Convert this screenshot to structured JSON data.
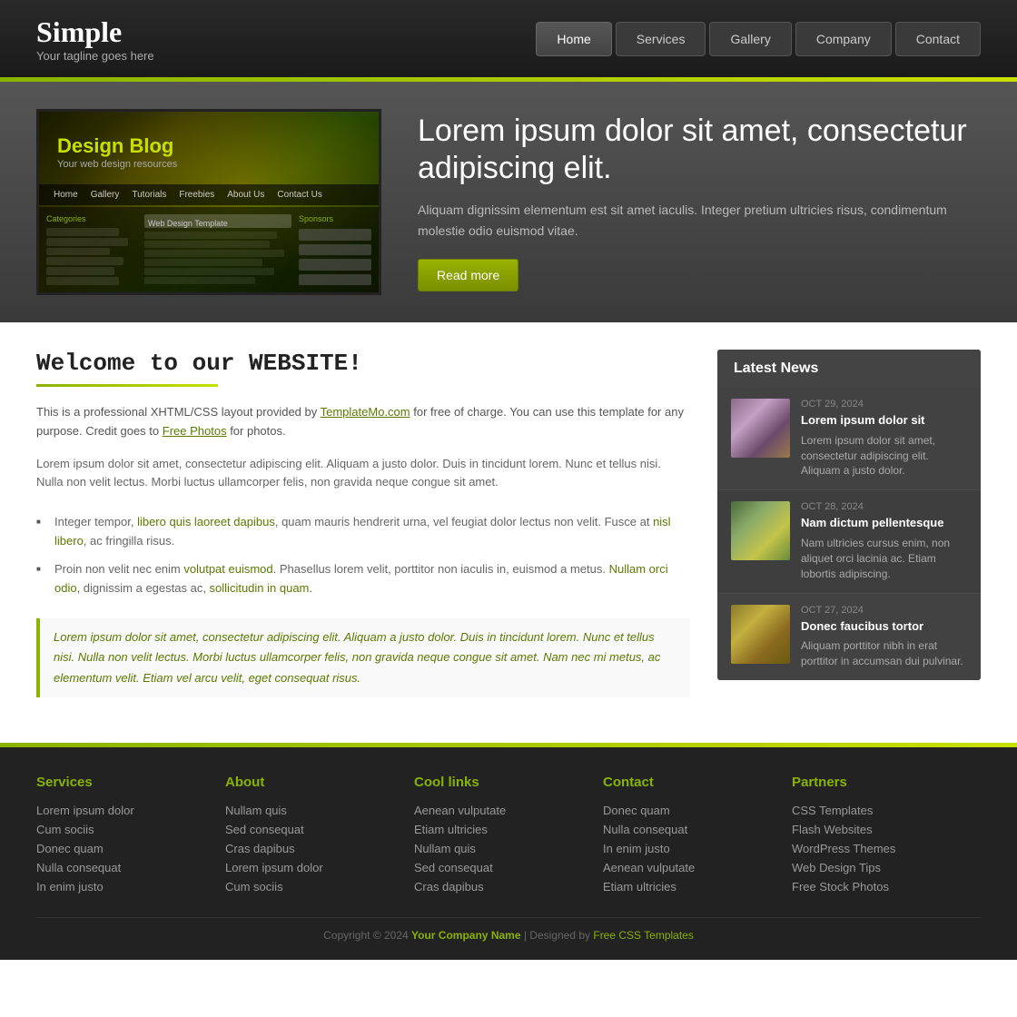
{
  "site": {
    "title": "Simple",
    "tagline": "Your tagline goes here"
  },
  "nav": {
    "items": [
      {
        "label": "Home",
        "active": true
      },
      {
        "label": "Services",
        "active": false
      },
      {
        "label": "Gallery",
        "active": false
      },
      {
        "label": "Company",
        "active": false
      },
      {
        "label": "Contact",
        "active": false
      }
    ]
  },
  "hero": {
    "heading": "Lorem ipsum dolor sit amet, consectetur adipiscing elit.",
    "body": "Aliquam dignissim elementum est sit amet iaculis. Integer pretium ultricies risus, condimentum molestie odio euismod vitae.",
    "read_more": "Read more",
    "image_title": "Design Blog",
    "image_subtitle": "Your web design resources"
  },
  "content": {
    "heading": "Welcome to our WEBSITE!",
    "intro": "This is a professional XHTML/CSS layout provided by TemplateMo.com for free of charge. You can use this template for any purpose. Credit goes to Free Photos for photos.",
    "paragraph": "Lorem ipsum dolor sit amet, consectetur adipiscing elit. Aliquam a justo dolor. Duis in tincidunt lorem. Nunc et tellus nisi. Nulla non velit lectus. Morbi luctus ullamcorper felis, non gravida neque congue sit amet.",
    "bullets": [
      "Integer tempor, libero quis laoreet dapibus, quam mauris hendrerit urna, vel feugiat dolor lectus non velit. Fusce at nisl libero, ac fringilla risus.",
      "Proin non velit nec enim volutpat euismod. Phasellus lorem velit, porttitor non iaculis in, euismod a metus. Nullam orci odio, dignissim a egestas ac, sollicitudin in quam."
    ],
    "blockquote": "Lorem ipsum dolor sit amet, consectetur adipiscing elit. Aliquam a justo dolor. Duis in tincidunt lorem. Nunc et tellus nisi. Nulla non velit lectus. Morbi luctus ullamcorper felis, non gravida neque congue sit amet. Nam nec mi metus, ac elementum velit. Etiam vel arcu velit, eget consequat risus."
  },
  "sidebar": {
    "title": "Latest News",
    "news": [
      {
        "date": "OCT 29, 2024",
        "title": "Lorem ipsum dolor sit",
        "excerpt": "Lorem ipsum dolor sit amet, consectetur adipiscing elit. Aliquam a justo dolor.",
        "thumb_class": "thumb-flowers"
      },
      {
        "date": "OCT 28, 2024",
        "title": "Nam dictum pellentesque",
        "excerpt": "Nam ultricies cursus enim, non aliquet orci lacinia ac. Etiam lobortis adipiscing.",
        "thumb_class": "thumb-daisy"
      },
      {
        "date": "OCT 27, 2024",
        "title": "Donec faucibus tortor",
        "excerpt": "Aliquam porttitor nibh in erat porttitor in accumsan dui pulvinar.",
        "thumb_class": "thumb-gold"
      }
    ]
  },
  "footer": {
    "columns": [
      {
        "title": "Services",
        "links": [
          "Lorem ipsum dolor",
          "Cum sociis",
          "Donec quam",
          "Nulla consequat",
          "In enim justo"
        ]
      },
      {
        "title": "About",
        "links": [
          "Nullam quis",
          "Sed consequat",
          "Cras dapibus",
          "Lorem ipsum dolor",
          "Cum sociis"
        ]
      },
      {
        "title": "Cool links",
        "links": [
          "Aenean vulputate",
          "Etiam ultricies",
          "Nullam quis",
          "Sed consequat",
          "Cras dapibus"
        ]
      },
      {
        "title": "Contact",
        "links": [
          "Donec quam",
          "Nulla consequat",
          "In enim justo",
          "Aenean vulputate",
          "Etiam ultricies"
        ]
      },
      {
        "title": "Partners",
        "links": [
          "CSS Templates",
          "Flash Websites",
          "WordPress Themes",
          "Web Design Tips",
          "Free Stock Photos"
        ]
      }
    ],
    "copyright": "Copyright © 2024",
    "company": "Your Company Name",
    "designed_by": "Designed by",
    "designer": "Free CSS Templates"
  }
}
